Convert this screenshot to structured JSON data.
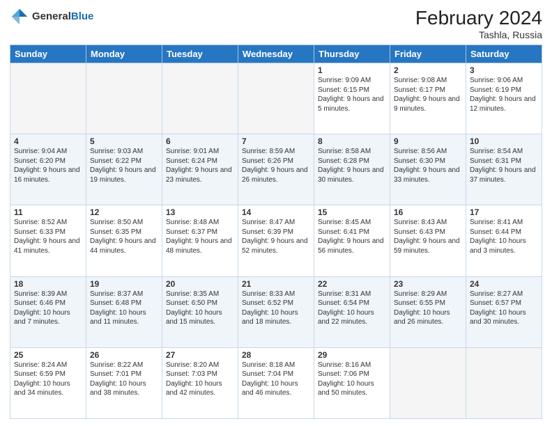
{
  "header": {
    "logo_general": "General",
    "logo_blue": "Blue",
    "month_title": "February 2024",
    "subtitle": "Tashla, Russia"
  },
  "days_of_week": [
    "Sunday",
    "Monday",
    "Tuesday",
    "Wednesday",
    "Thursday",
    "Friday",
    "Saturday"
  ],
  "weeks": [
    [
      {
        "day": "",
        "info": ""
      },
      {
        "day": "",
        "info": ""
      },
      {
        "day": "",
        "info": ""
      },
      {
        "day": "",
        "info": ""
      },
      {
        "day": "1",
        "info": "Sunrise: 9:09 AM\nSunset: 6:15 PM\nDaylight: 9 hours\nand 5 minutes."
      },
      {
        "day": "2",
        "info": "Sunrise: 9:08 AM\nSunset: 6:17 PM\nDaylight: 9 hours\nand 9 minutes."
      },
      {
        "day": "3",
        "info": "Sunrise: 9:06 AM\nSunset: 6:19 PM\nDaylight: 9 hours\nand 12 minutes."
      }
    ],
    [
      {
        "day": "4",
        "info": "Sunrise: 9:04 AM\nSunset: 6:20 PM\nDaylight: 9 hours\nand 16 minutes."
      },
      {
        "day": "5",
        "info": "Sunrise: 9:03 AM\nSunset: 6:22 PM\nDaylight: 9 hours\nand 19 minutes."
      },
      {
        "day": "6",
        "info": "Sunrise: 9:01 AM\nSunset: 6:24 PM\nDaylight: 9 hours\nand 23 minutes."
      },
      {
        "day": "7",
        "info": "Sunrise: 8:59 AM\nSunset: 6:26 PM\nDaylight: 9 hours\nand 26 minutes."
      },
      {
        "day": "8",
        "info": "Sunrise: 8:58 AM\nSunset: 6:28 PM\nDaylight: 9 hours\nand 30 minutes."
      },
      {
        "day": "9",
        "info": "Sunrise: 8:56 AM\nSunset: 6:30 PM\nDaylight: 9 hours\nand 33 minutes."
      },
      {
        "day": "10",
        "info": "Sunrise: 8:54 AM\nSunset: 6:31 PM\nDaylight: 9 hours\nand 37 minutes."
      }
    ],
    [
      {
        "day": "11",
        "info": "Sunrise: 8:52 AM\nSunset: 6:33 PM\nDaylight: 9 hours\nand 41 minutes."
      },
      {
        "day": "12",
        "info": "Sunrise: 8:50 AM\nSunset: 6:35 PM\nDaylight: 9 hours\nand 44 minutes."
      },
      {
        "day": "13",
        "info": "Sunrise: 8:48 AM\nSunset: 6:37 PM\nDaylight: 9 hours\nand 48 minutes."
      },
      {
        "day": "14",
        "info": "Sunrise: 8:47 AM\nSunset: 6:39 PM\nDaylight: 9 hours\nand 52 minutes."
      },
      {
        "day": "15",
        "info": "Sunrise: 8:45 AM\nSunset: 6:41 PM\nDaylight: 9 hours\nand 56 minutes."
      },
      {
        "day": "16",
        "info": "Sunrise: 8:43 AM\nSunset: 6:43 PM\nDaylight: 9 hours\nand 59 minutes."
      },
      {
        "day": "17",
        "info": "Sunrise: 8:41 AM\nSunset: 6:44 PM\nDaylight: 10 hours\nand 3 minutes."
      }
    ],
    [
      {
        "day": "18",
        "info": "Sunrise: 8:39 AM\nSunset: 6:46 PM\nDaylight: 10 hours\nand 7 minutes."
      },
      {
        "day": "19",
        "info": "Sunrise: 8:37 AM\nSunset: 6:48 PM\nDaylight: 10 hours\nand 11 minutes."
      },
      {
        "day": "20",
        "info": "Sunrise: 8:35 AM\nSunset: 6:50 PM\nDaylight: 10 hours\nand 15 minutes."
      },
      {
        "day": "21",
        "info": "Sunrise: 8:33 AM\nSunset: 6:52 PM\nDaylight: 10 hours\nand 18 minutes."
      },
      {
        "day": "22",
        "info": "Sunrise: 8:31 AM\nSunset: 6:54 PM\nDaylight: 10 hours\nand 22 minutes."
      },
      {
        "day": "23",
        "info": "Sunrise: 8:29 AM\nSunset: 6:55 PM\nDaylight: 10 hours\nand 26 minutes."
      },
      {
        "day": "24",
        "info": "Sunrise: 8:27 AM\nSunset: 6:57 PM\nDaylight: 10 hours\nand 30 minutes."
      }
    ],
    [
      {
        "day": "25",
        "info": "Sunrise: 8:24 AM\nSunset: 6:59 PM\nDaylight: 10 hours\nand 34 minutes."
      },
      {
        "day": "26",
        "info": "Sunrise: 8:22 AM\nSunset: 7:01 PM\nDaylight: 10 hours\nand 38 minutes."
      },
      {
        "day": "27",
        "info": "Sunrise: 8:20 AM\nSunset: 7:03 PM\nDaylight: 10 hours\nand 42 minutes."
      },
      {
        "day": "28",
        "info": "Sunrise: 8:18 AM\nSunset: 7:04 PM\nDaylight: 10 hours\nand 46 minutes."
      },
      {
        "day": "29",
        "info": "Sunrise: 8:16 AM\nSunset: 7:06 PM\nDaylight: 10 hours\nand 50 minutes."
      },
      {
        "day": "",
        "info": ""
      },
      {
        "day": "",
        "info": ""
      }
    ]
  ]
}
